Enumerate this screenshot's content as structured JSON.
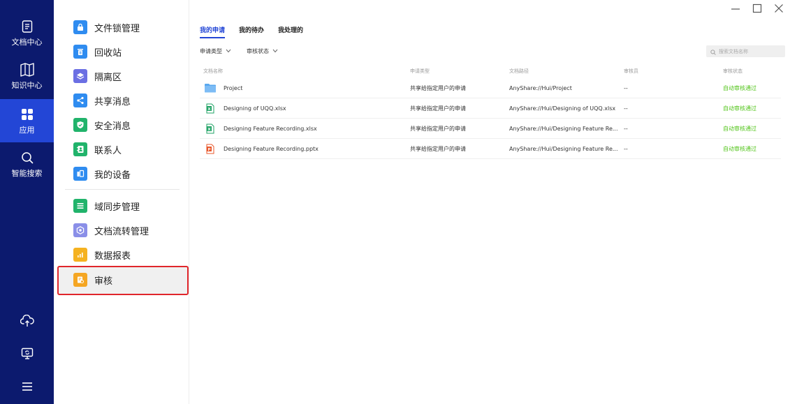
{
  "rail": {
    "items": [
      {
        "label": "文档中心",
        "icon": "document-icon"
      },
      {
        "label": "知识中心",
        "icon": "map-book-icon"
      },
      {
        "label": "应用",
        "icon": "apps-grid-icon"
      },
      {
        "label": "智能搜索",
        "icon": "search-icon"
      }
    ],
    "bottom": [
      "cloud-upload-icon",
      "monitor-sync-icon",
      "menu-icon"
    ]
  },
  "apps": {
    "items": [
      {
        "label": "文件锁管理",
        "color": "#2f8cf0",
        "icon": "lock-icon"
      },
      {
        "label": "回收站",
        "color": "#2f8cf0",
        "icon": "trash-icon"
      },
      {
        "label": "隔离区",
        "color": "#6b6fe3",
        "icon": "layers-icon"
      },
      {
        "label": "共享消息",
        "color": "#2f8cf0",
        "icon": "share-icon"
      },
      {
        "label": "安全消息",
        "color": "#21b36b",
        "icon": "shield-icon"
      },
      {
        "label": "联系人",
        "color": "#21b36b",
        "icon": "contact-icon"
      },
      {
        "label": "我的设备",
        "color": "#2f8cf0",
        "icon": "device-icon"
      },
      {
        "label": "域同步管理",
        "color": "#21b36b",
        "icon": "list-icon"
      },
      {
        "label": "文档流转管理",
        "color": "#8a8fe8",
        "icon": "flow-icon"
      },
      {
        "label": "数据报表",
        "color": "#f5b220",
        "icon": "chart-icon"
      },
      {
        "label": "审核",
        "color": "#f5a623",
        "icon": "audit-icon"
      }
    ]
  },
  "tabs": [
    "我的申请",
    "我的待办",
    "我处理的"
  ],
  "filters": [
    "申请类型",
    "审核状态"
  ],
  "search": {
    "placeholder": "搜索文档名称"
  },
  "table": {
    "columns": [
      "文档名称",
      "申请类型",
      "文档路径",
      "审核员",
      "审核状态"
    ],
    "rows": [
      {
        "name": "Project",
        "type": "共享给指定用户的申请",
        "path": "AnyShare://Hui/Project",
        "reviewer": "--",
        "status": "自动审核通过",
        "icon": "folder-icon"
      },
      {
        "name": "Designing of UQQ.xlsx",
        "type": "共享给指定用户的申请",
        "path": "AnyShare://Hui/Designing of UQQ.xlsx",
        "reviewer": "--",
        "status": "自动审核通过",
        "icon": "excel-icon"
      },
      {
        "name": "Designing Feature Recording.xlsx",
        "type": "共享给指定用户的申请",
        "path": "AnyShare://Hui/Designing Feature Re...",
        "reviewer": "--",
        "status": "自动审核通过",
        "icon": "excel-icon"
      },
      {
        "name": "Designing Feature Recording.pptx",
        "type": "共享给指定用户的申请",
        "path": "AnyShare://Hui/Designing Feature Re...",
        "reviewer": "--",
        "status": "自动审核通过",
        "icon": "ppt-icon"
      }
    ]
  }
}
